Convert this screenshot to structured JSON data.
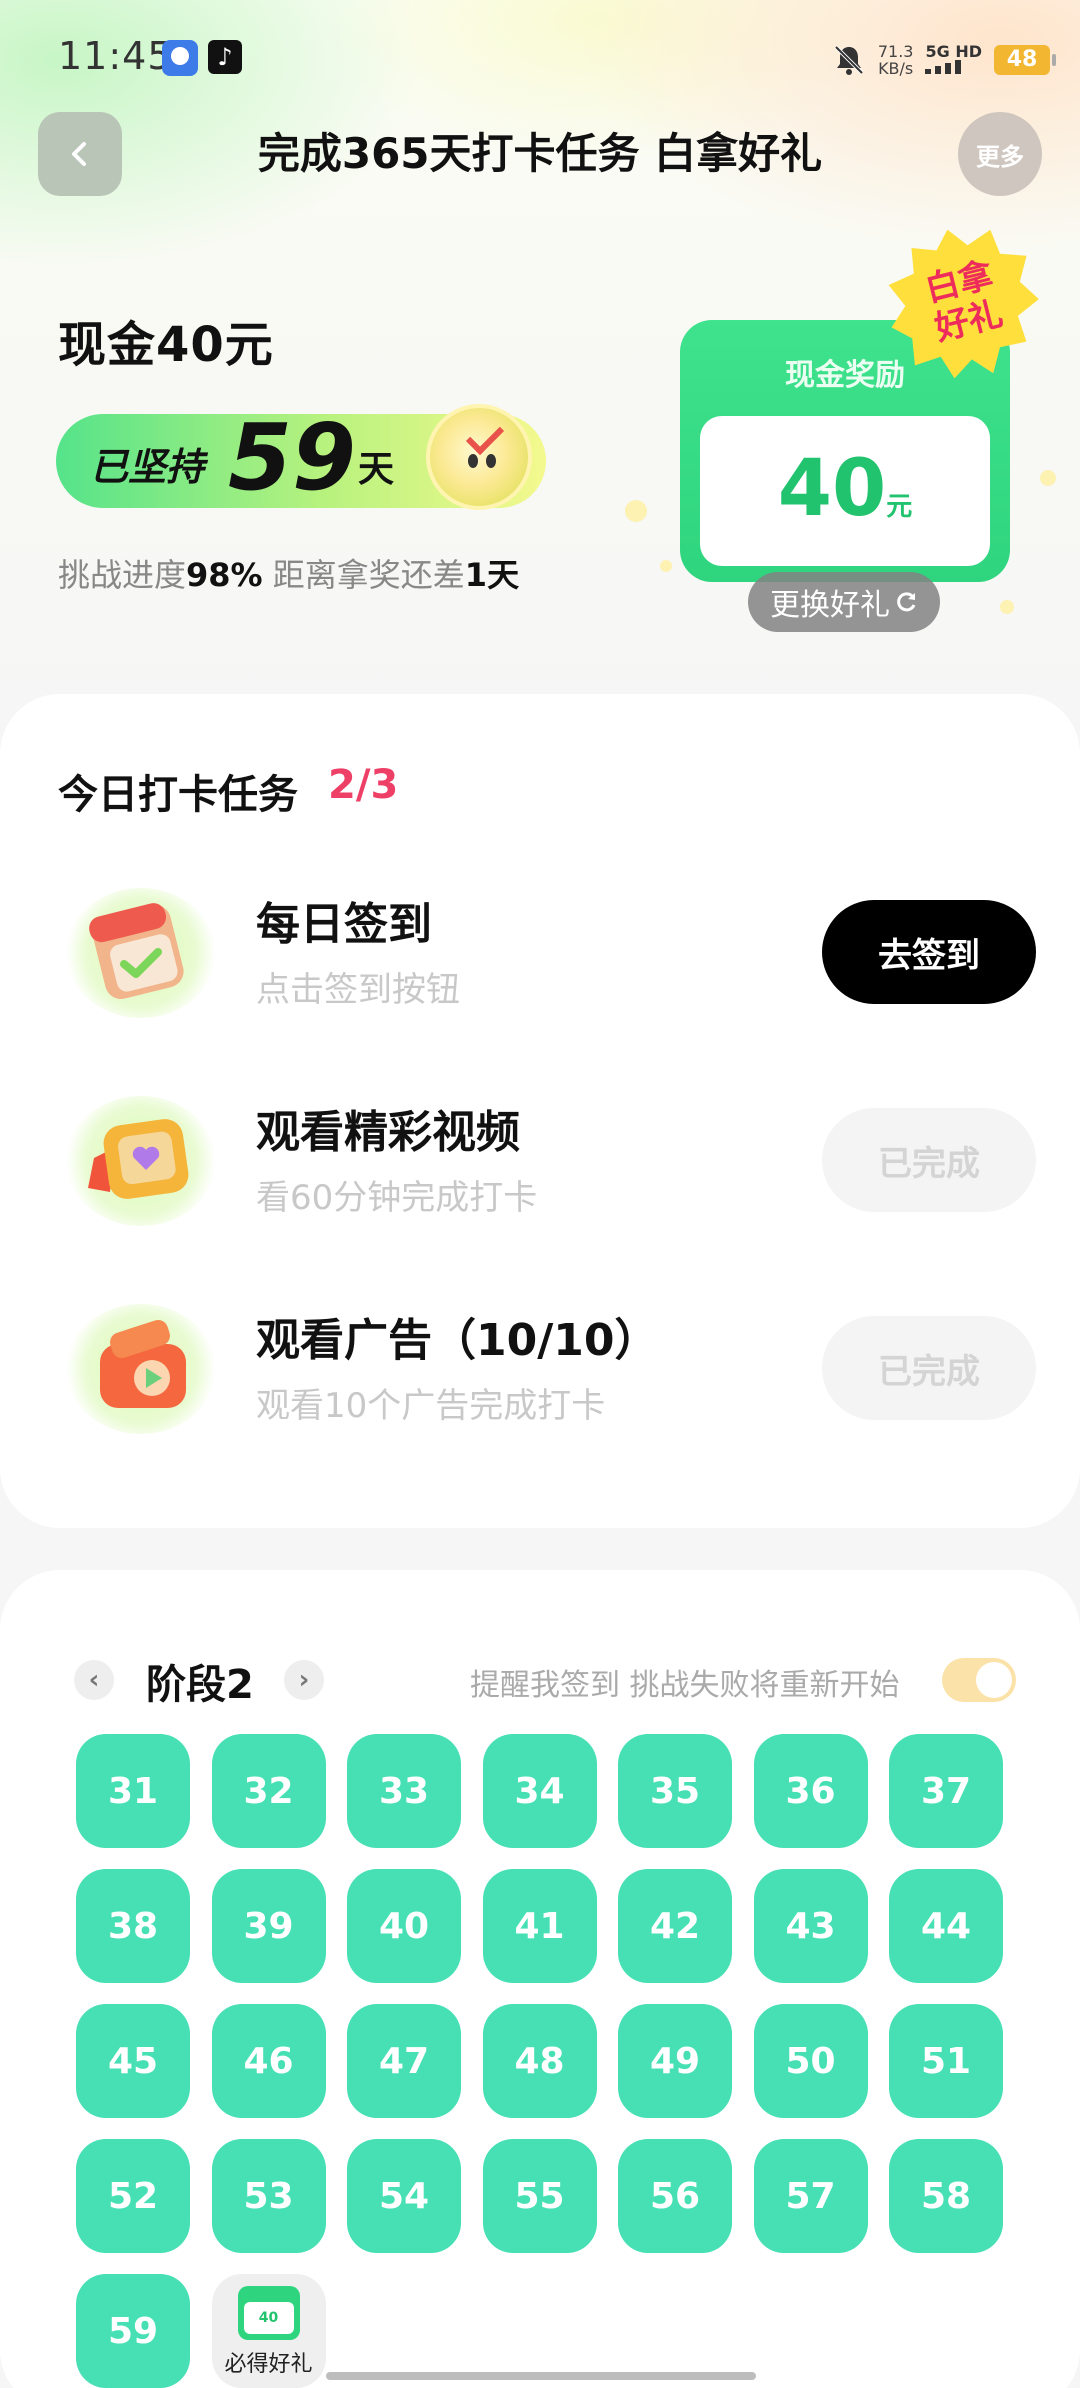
{
  "status_bar": {
    "time": "11:45",
    "net_speed_value": "71.3",
    "net_speed_unit": "KB/s",
    "network": "5G HD",
    "battery": "48"
  },
  "header": {
    "back_icon": "chevron-left-icon",
    "title": "完成365天打卡任务 白拿好礼",
    "more_label": "更多"
  },
  "hero": {
    "cash_title": "现金40元",
    "streak_prefix": "已坚持",
    "streak_days": "59",
    "streak_unit": "天",
    "progress_label": "挑战进度",
    "progress_value": "98%",
    "remain_label": " 距离拿奖还差",
    "remain_value": "1天",
    "reward_card": {
      "label": "现金奖励",
      "value": "40",
      "unit": "元",
      "badge_line1": "白拿",
      "badge_line2": "好礼"
    },
    "swap_label": "更换好礼"
  },
  "tasks": {
    "heading": "今日打卡任务",
    "count": "2/3",
    "items": [
      {
        "title": "每日签到",
        "subtitle": "点击签到按钮",
        "button": "去签到",
        "icon": "calendar-check-icon"
      },
      {
        "title": "观看精彩视频",
        "subtitle": "看60分钟完成打卡",
        "button": "已完成",
        "icon": "video-heart-icon"
      },
      {
        "title": "观看广告（10/10）",
        "subtitle": "观看10个广告完成打卡",
        "button": "已完成",
        "icon": "ad-play-icon"
      }
    ]
  },
  "stage": {
    "title": "阶段2",
    "prev_icon": "chevron-left-icon",
    "next_icon": "chevron-right-icon",
    "remind_text": "提醒我签到 挑战失败将重新开始",
    "remind_toggle_on": true,
    "days": [
      "31",
      "32",
      "33",
      "34",
      "35",
      "36",
      "37",
      "38",
      "39",
      "40",
      "41",
      "42",
      "43",
      "44",
      "45",
      "46",
      "47",
      "48",
      "49",
      "50",
      "51",
      "52",
      "53",
      "54",
      "55",
      "56",
      "57",
      "58",
      "59"
    ],
    "gift_cell": {
      "mini_value": "40",
      "label": "必得好礼"
    }
  },
  "colors": {
    "accent_green": "#46e0b4",
    "reward_green": "#2fd57e",
    "count_red": "#ee3f67"
  }
}
